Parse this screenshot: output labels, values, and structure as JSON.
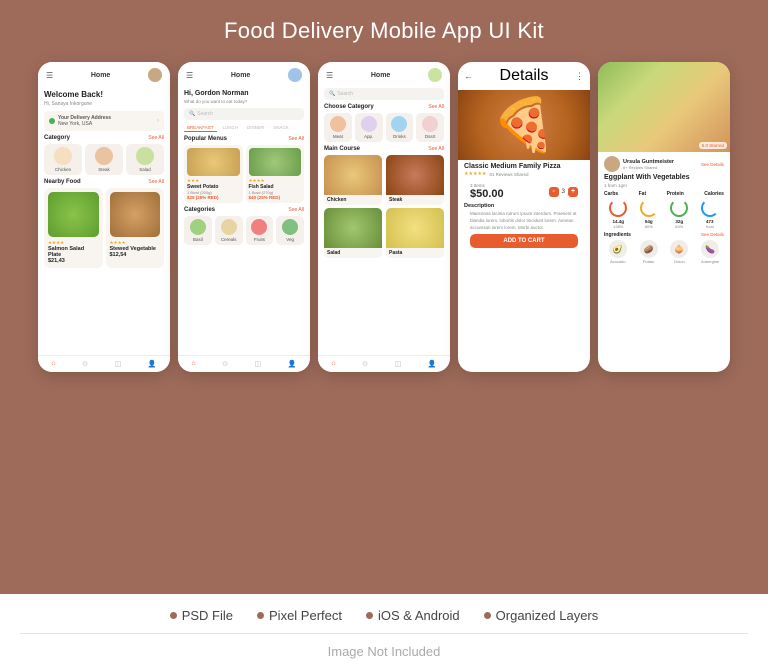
{
  "page": {
    "title": "Food Delivery Mobile App UI Kit",
    "bg_color": "#9e6b5a"
  },
  "features": [
    {
      "id": "psd",
      "label": "PSD File"
    },
    {
      "id": "pixel",
      "label": "Pixel Perfect"
    },
    {
      "id": "ios",
      "label": "iOS & Android"
    },
    {
      "id": "layers",
      "label": "Organized Layers"
    }
  ],
  "footer": {
    "image_note": "Image Not Included"
  },
  "screens": [
    {
      "id": "screen1",
      "topbar": {
        "title": "Home"
      },
      "welcome": "Welcome Back!",
      "sub": "Hi, Sanaya Inkorgune",
      "delivery_label": "Your Delivery Address",
      "delivery_address": "New York, USA",
      "category_title": "Category",
      "categories": [
        "Chicken",
        "Steak",
        "Salad"
      ],
      "nearby_title": "Nearby Food",
      "foods": [
        {
          "name": "Salmon Salad Plate",
          "price": "$21,43"
        },
        {
          "name": "Stewed Vegetable",
          "price": "$12,54"
        }
      ]
    },
    {
      "id": "screen2",
      "topbar": {
        "title": "Home"
      },
      "greeting": "Hi, Gordon Norman",
      "sub": "What do you want to eat today?",
      "search_placeholder": "Search",
      "tabs": [
        "BREAKFAST",
        "LUNCH",
        "DINNER",
        "SNACK"
      ],
      "popular_title": "Popular Menus",
      "menus": [
        {
          "name": "Sweet Potato",
          "detail": "1 Bowl (200g)",
          "price": "$20 (25% RED)"
        },
        {
          "name": "Fish Salad",
          "detail": "1 Bowl (270g)",
          "price": "$40 (25% RED)"
        }
      ],
      "categories_title": "Categories",
      "cats": [
        "Basil",
        "Cereals",
        "Fruits",
        "Vegetables"
      ]
    },
    {
      "id": "screen3",
      "topbar": {
        "title": "Home"
      },
      "choose_title": "Choose Category",
      "cat_icons": [
        "Meat",
        "Appetizer",
        "Drinks",
        "Dessert"
      ],
      "main_course_title": "Main Course",
      "courses": [
        "Chicken",
        "Steak",
        "Salad",
        "Pasta"
      ]
    },
    {
      "id": "screen4",
      "topbar": {
        "title": "Details"
      },
      "food_name": "Classic Medium Family Pizza",
      "rating": "4.8",
      "reviews": "81 Reviews Shared",
      "desc": "Maecenas lacinia rutrum ipsum interdum. Praesent at blandia lorem, lobortis dolor tincidunt lorem. Aenean accumsan lorem lorem. Morbi auctor.",
      "price": "$50.00",
      "qty": "3",
      "btn_label": "ADD TO CART"
    },
    {
      "id": "screen5",
      "user": {
        "name": "Ursula Guntmeister",
        "role": "6+ Recipes Shared",
        "rating": "5.0 Starred"
      },
      "food_name": "Eggplant With Vegetables",
      "food_sub": "1 from 1gm",
      "macros": [
        {
          "label": "Carbs",
          "val": "14.4g / 138%",
          "type": "carbs"
        },
        {
          "label": "Fat",
          "val": "54g / 80%",
          "type": "fat"
        },
        {
          "label": "Protein",
          "val": "32g / 64%",
          "type": "protein"
        },
        {
          "label": "Calories",
          "val": "473 Kcal",
          "type": "calories"
        }
      ],
      "ingredients_title": "Ingredients",
      "ingredients": [
        "Avocado",
        "Potato",
        "Onion",
        "Aubergine"
      ]
    }
  ]
}
